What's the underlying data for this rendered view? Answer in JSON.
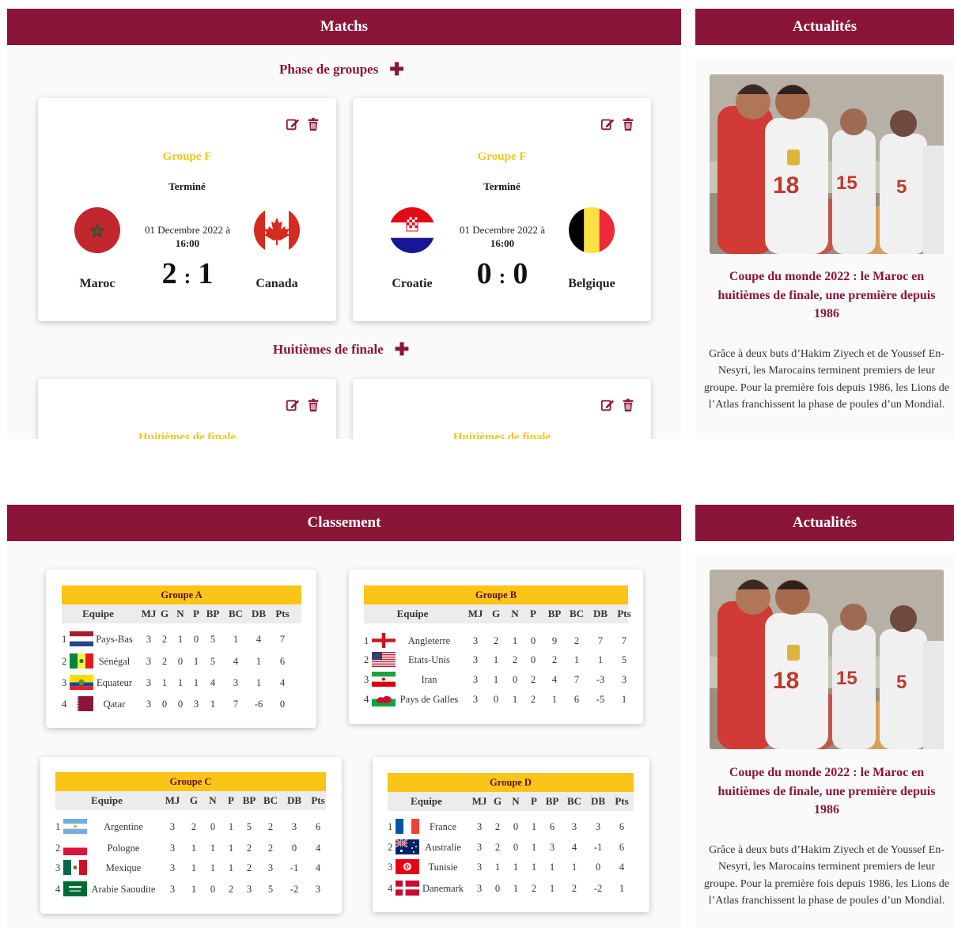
{
  "matchs": {
    "header": "Matchs",
    "phases": [
      {
        "label": "Phase de groupes"
      },
      {
        "label": "Huitièmes de finale"
      }
    ],
    "cards": [
      {
        "group": "Groupe F",
        "status": "Terminé",
        "date": "01 Decembre 2022 à",
        "time": "16:00",
        "home": "Maroc",
        "away": "Canada",
        "home_score": "2",
        "away_score": "1"
      },
      {
        "group": "Groupe F",
        "status": "Terminé",
        "date": "01 Decembre 2022 à",
        "time": "16:00",
        "home": "Croatie",
        "away": "Belgique",
        "home_score": "0",
        "away_score": "0"
      },
      {
        "group": "Huitièmes de finale"
      },
      {
        "group": "Huitièmes de finale"
      }
    ],
    "score_sep": ":"
  },
  "actualites": {
    "header": "Actualités",
    "title": "Coupe du monde 2022 : le Maroc en huitièmes de finale, une première depuis 1986",
    "text": "Grâce à deux buts d’Hakim Ziyech et de Youssef En-Nesyri, les Marocains terminent premiers de leur groupe. Pour la première fois depuis 1986, les Lions de l’Atlas franchissent la phase de poules d’un Mondial."
  },
  "classement": {
    "header": "Classement",
    "columns": [
      "Equipe",
      "MJ",
      "G",
      "N",
      "P",
      "BP",
      "BC",
      "DB",
      "Pts"
    ],
    "groups": [
      {
        "name": "Groupe A",
        "rows": [
          {
            "rank": "1",
            "team": "Pays-Bas",
            "flag": "nl-flag",
            "stats": [
              "3",
              "2",
              "1",
              "0",
              "5",
              "1",
              "4",
              "7"
            ]
          },
          {
            "rank": "2",
            "team": "Sénégal",
            "flag": "sn-flag",
            "stats": [
              "3",
              "2",
              "0",
              "1",
              "5",
              "4",
              "1",
              "6"
            ]
          },
          {
            "rank": "3",
            "team": "Equateur",
            "flag": "ec-flag",
            "stats": [
              "3",
              "1",
              "1",
              "1",
              "4",
              "3",
              "1",
              "4"
            ]
          },
          {
            "rank": "4",
            "team": "Qatar",
            "flag": "qa-flag",
            "stats": [
              "3",
              "0",
              "0",
              "3",
              "1",
              "7",
              "-6",
              "0"
            ]
          }
        ]
      },
      {
        "name": "Groupe B",
        "rows": [
          {
            "rank": "1",
            "team": "Angleterre",
            "flag": "en-flag",
            "stats": [
              "3",
              "2",
              "1",
              "0",
              "9",
              "2",
              "7",
              "7"
            ]
          },
          {
            "rank": "2",
            "team": "Etats-Unis",
            "flag": "us-flag",
            "stats": [
              "3",
              "1",
              "2",
              "0",
              "2",
              "1",
              "1",
              "5"
            ]
          },
          {
            "rank": "3",
            "team": "Iran",
            "flag": "ir-flag",
            "stats": [
              "3",
              "1",
              "0",
              "2",
              "4",
              "7",
              "-3",
              "3"
            ]
          },
          {
            "rank": "4",
            "team": "Pays de Galles",
            "flag": "wl-flag",
            "stats": [
              "3",
              "0",
              "1",
              "2",
              "1",
              "6",
              "-5",
              "1"
            ]
          }
        ]
      },
      {
        "name": "Groupe C",
        "rows": [
          {
            "rank": "1",
            "team": "Argentine",
            "flag": "ar-flag",
            "stats": [
              "3",
              "2",
              "0",
              "1",
              "5",
              "2",
              "3",
              "6"
            ]
          },
          {
            "rank": "2",
            "team": "Pologne",
            "flag": "pl-flag",
            "stats": [
              "3",
              "1",
              "1",
              "1",
              "2",
              "2",
              "0",
              "4"
            ]
          },
          {
            "rank": "3",
            "team": "Mexique",
            "flag": "mx-flag",
            "stats": [
              "3",
              "1",
              "1",
              "1",
              "2",
              "3",
              "-1",
              "4"
            ]
          },
          {
            "rank": "4",
            "team": "Arabie Saoudite",
            "flag": "sa-flag",
            "stats": [
              "3",
              "1",
              "0",
              "2",
              "3",
              "5",
              "-2",
              "3"
            ]
          }
        ]
      },
      {
        "name": "Groupe D",
        "rows": [
          {
            "rank": "1",
            "team": "France",
            "flag": "fr-flag",
            "stats": [
              "3",
              "2",
              "0",
              "1",
              "6",
              "3",
              "3",
              "6"
            ]
          },
          {
            "rank": "2",
            "team": "Australie",
            "flag": "au-flag",
            "stats": [
              "3",
              "2",
              "0",
              "1",
              "3",
              "4",
              "-1",
              "6"
            ]
          },
          {
            "rank": "3",
            "team": "Tunisie",
            "flag": "tn-flag",
            "stats": [
              "3",
              "1",
              "1",
              "1",
              "1",
              "1",
              "0",
              "4"
            ]
          },
          {
            "rank": "4",
            "team": "Danemark",
            "flag": "dk-flag",
            "stats": [
              "3",
              "0",
              "1",
              "2",
              "1",
              "2",
              "-2",
              "1"
            ]
          }
        ]
      }
    ]
  },
  "colors": {
    "primary": "#8b1538",
    "accent": "#f5c518",
    "group_header": "#fbc517"
  }
}
